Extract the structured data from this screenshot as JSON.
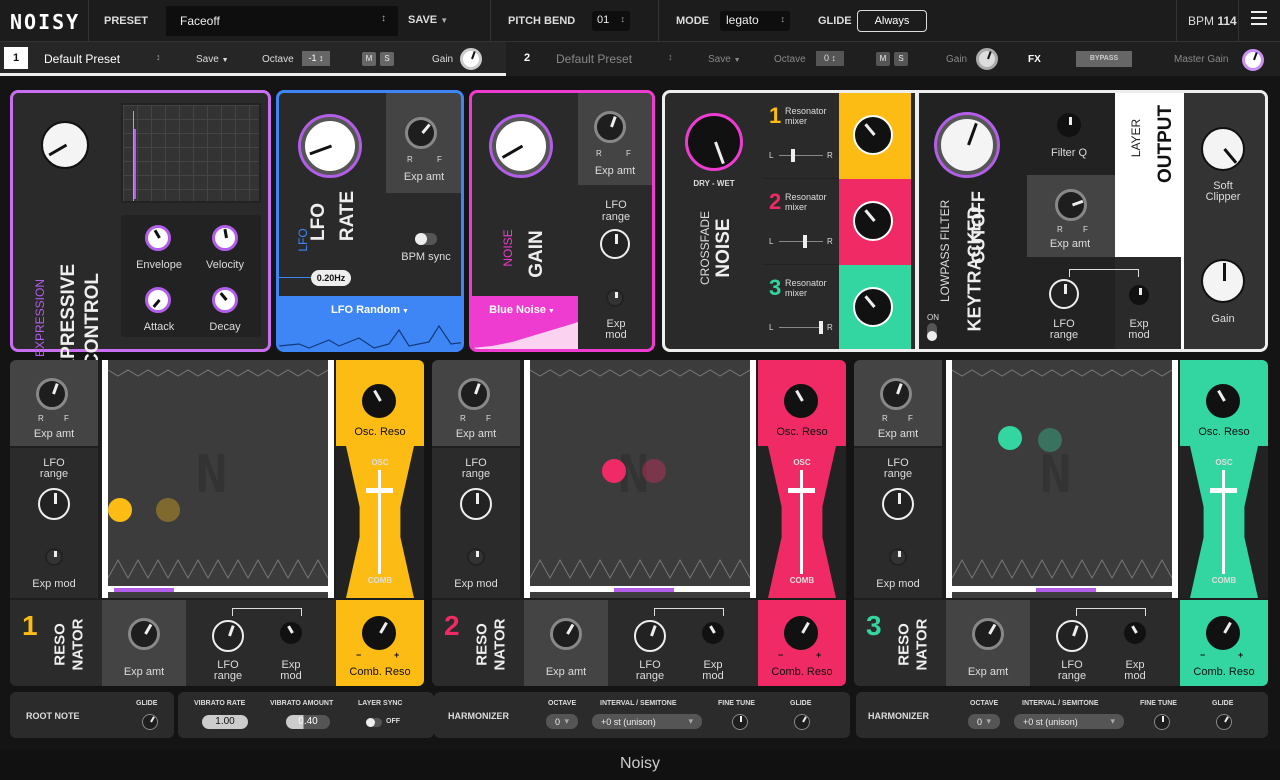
{
  "colors": {
    "yellow": "#fcbc14",
    "pink": "#ef2a64",
    "teal": "#33d6a0",
    "purple": "#b25ee8",
    "blue": "#3e86f6",
    "magenta": "#ed3ccf"
  },
  "topbar": {
    "logo": "NOISY",
    "preset_label": "PRESET",
    "preset_value": "Faceoff",
    "save": "SAVE",
    "pitch_bend_label": "PITCH BEND",
    "pitch_bend_value": "01",
    "mode_label": "MODE",
    "mode_value": "legato",
    "glide_label": "GLIDE",
    "glide_value": "Always",
    "bpm_label": "BPM",
    "bpm_value": "114"
  },
  "layerbar": {
    "layer1": {
      "num": "1",
      "preset": "Default Preset",
      "save": "Save",
      "octave_label": "Octave",
      "octave_value": "-1",
      "m": "M",
      "s": "S",
      "gain": "Gain"
    },
    "layer2": {
      "num": "2",
      "preset": "Default Preset",
      "save": "Save",
      "octave_label": "Octave",
      "octave_value": "0",
      "m": "M",
      "s": "S",
      "gain": "Gain"
    },
    "fx": "FX",
    "bypass": "BYPASS",
    "master_gain": "Master Gain"
  },
  "expressive": {
    "small": "EXPRESSION",
    "title1": "EXPRESSIVE",
    "title2": "CONTROL",
    "knobs": [
      "Envelope",
      "Velocity",
      "Attack",
      "Decay"
    ]
  },
  "lfo": {
    "small": "LFO",
    "title1": "LFO",
    "title2": "RATE",
    "rate": "0.20Hz",
    "exp_amt": "Exp amt",
    "r": "R",
    "f": "F",
    "bpm_sync": "BPM sync",
    "shape": "LFO Random"
  },
  "noise": {
    "small": "NOISE",
    "title": "GAIN",
    "exp_amt": "Exp amt",
    "lfo_range": "LFO range",
    "exp_mod": "Exp mod",
    "shape": "Blue Noise",
    "r": "R",
    "f": "F"
  },
  "crossfade": {
    "dry_wet": "DRY - WET",
    "title1": "CROSSFADE",
    "title2": "NOISE",
    "mixers": [
      {
        "num": "1",
        "label": "Resonator mixer"
      },
      {
        "num": "2",
        "label": "Resonator mixer"
      },
      {
        "num": "3",
        "label": "Resonator mixer"
      }
    ],
    "l": "L",
    "r": "R"
  },
  "filter": {
    "small": "LOWPASS FILTER",
    "title1": "KEYTRACKED",
    "title2": "CUTOFF",
    "filter_q": "Filter Q",
    "exp_amt": "Exp amt",
    "lfo_range": "LFO range",
    "exp_mod": "Exp mod",
    "on": "ON",
    "r": "R",
    "f": "F"
  },
  "output": {
    "small": "LAYER",
    "title": "OUTPUT",
    "soft_clipper": "Soft Clipper",
    "gain": "Gain"
  },
  "resonators": [
    {
      "num": "1",
      "name1": "RESO",
      "name2": "NATOR",
      "exp_amt": "Exp amt",
      "lfo_range": "LFO range",
      "exp_mod": "Exp mod",
      "osc_reso": "Osc. Reso",
      "osc": "OSC",
      "comb": "COMB",
      "comb_reso": "Comb. Reso",
      "minus": "−",
      "plus": "+",
      "r": "R",
      "f": "F"
    },
    {
      "num": "2",
      "name1": "RESO",
      "name2": "NATOR",
      "exp_amt": "Exp amt",
      "lfo_range": "LFO range",
      "exp_mod": "Exp mod",
      "osc_reso": "Osc. Reso",
      "osc": "OSC",
      "comb": "COMB",
      "comb_reso": "Comb. Reso",
      "minus": "−",
      "plus": "+",
      "r": "R",
      "f": "F"
    },
    {
      "num": "3",
      "name1": "RESO",
      "name2": "NATOR",
      "exp_amt": "Exp amt",
      "lfo_range": "LFO range",
      "exp_mod": "Exp mod",
      "osc_reso": "Osc. Reso",
      "osc": "OSC",
      "comb": "COMB",
      "comb_reso": "Comb. Reso",
      "minus": "−",
      "plus": "+",
      "r": "R",
      "f": "F"
    }
  ],
  "bottom": {
    "root_note": "ROOT NOTE",
    "glide": "GLIDE",
    "vibrato_rate_label": "VIBRATO RATE",
    "vibrato_rate": "1.00",
    "vibrato_amount_label": "VIBRATO AMOUNT",
    "vibrato_amount": "0.40",
    "layer_sync_label": "LAYER SYNC",
    "layer_sync": "OFF",
    "harmonizers": [
      {
        "label": "HARMONIZER",
        "octave_label": "OCTAVE",
        "octave": "0",
        "interval_label": "INTERVAL / SEMITONE",
        "interval": "+0 st (unison)",
        "fine_tune": "FINE TUNE",
        "glide": "GLIDE"
      },
      {
        "label": "HARMONIZER",
        "octave_label": "OCTAVE",
        "octave": "0",
        "interval_label": "INTERVAL / SEMITONE",
        "interval": "+0 st (unison)",
        "fine_tune": "FINE TUNE",
        "glide": "GLIDE"
      }
    ]
  },
  "footer": {
    "title": "Noisy"
  }
}
